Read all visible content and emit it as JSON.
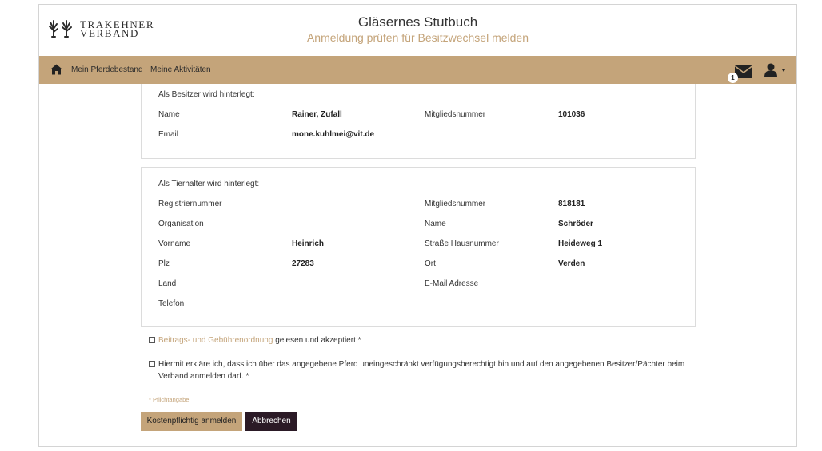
{
  "logo": {
    "line1": "TRAKEHNER",
    "line2": "VERBAND"
  },
  "header": {
    "title": "Gläsernes Stutbuch",
    "subtitle": "Anmeldung prüfen für Besitzwechsel melden"
  },
  "nav": {
    "links": [
      "Mein Pferdebestand",
      "Meine Aktivitäten"
    ],
    "mail_badge": "1",
    "icons": [
      "home-icon",
      "mail-icon",
      "user-icon",
      "caret-down-icon"
    ]
  },
  "owner": {
    "heading": "Als Besitzer wird hinterlegt:",
    "name_label": "Name",
    "name_value": "Rainer, Zufall",
    "member_label": "Mitgliedsnummer",
    "member_value": "101036",
    "email_label": "Email",
    "email_value": "mone.kuhlmei@vit.de"
  },
  "keeper": {
    "heading": "Als Tierhalter wird hinterlegt:",
    "registration_label": "Registriernummer",
    "registration_value": "",
    "member_label": "Mitgliedsnummer",
    "member_value": "818181",
    "org_label": "Organisation",
    "org_value": "",
    "name_label": "Name",
    "name_value": "Schröder",
    "firstname_label": "Vorname",
    "firstname_value": "Heinrich",
    "street_label": "Straße Hausnummer",
    "street_value": "Heideweg 1",
    "zip_label": "Plz",
    "zip_value": "27283",
    "city_label": "Ort",
    "city_value": "Verden",
    "country_label": "Land",
    "country_value": "",
    "email_label": "E-Mail Adresse",
    "email_value": "",
    "phone_label": "Telefon",
    "phone_value": ""
  },
  "agreements": {
    "fees_link": "Beitrags- und Gebührenordnung",
    "fees_rest": " gelesen und akzeptiert *",
    "declaration": "Hiermit erkläre ich, dass ich über das angegebene Pferd uneingeschränkt verfügungsberechtigt bin und auf den angegebenen Besitzer/Pächter beim Verband anmelden darf. *",
    "required_hint": "* Pflichtangabe"
  },
  "buttons": {
    "submit": "Kostenpflichtig anmelden",
    "cancel": "Abbrechen"
  },
  "colors": {
    "accent": "#c4a47a",
    "cancel_button": "#2b1a26",
    "text": "#333333"
  }
}
